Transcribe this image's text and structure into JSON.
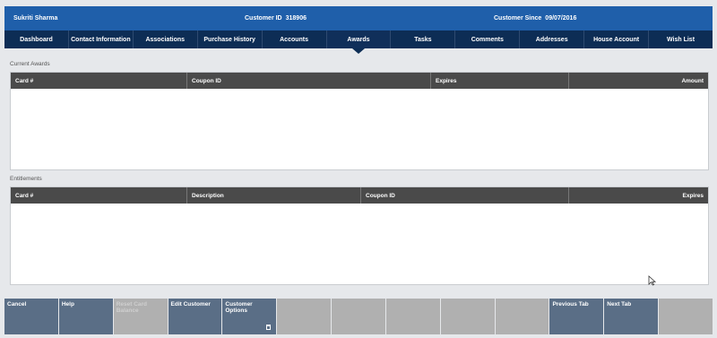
{
  "header": {
    "customer_name": "Sukriti Sharma",
    "customer_id_label": "Customer ID",
    "customer_id": "318906",
    "customer_since_label": "Customer Since",
    "customer_since": "09/07/2016"
  },
  "tabs": [
    {
      "label": "Dashboard"
    },
    {
      "label": "Contact Information"
    },
    {
      "label": "Associations"
    },
    {
      "label": "Purchase History"
    },
    {
      "label": "Accounts"
    },
    {
      "label": "Awards",
      "active": true
    },
    {
      "label": "Tasks"
    },
    {
      "label": "Comments"
    },
    {
      "label": "Addresses"
    },
    {
      "label": "House Account"
    },
    {
      "label": "Wish List"
    }
  ],
  "current_awards": {
    "title": "Current Awards",
    "columns": [
      "Card #",
      "Coupon ID",
      "Expires",
      "Amount"
    ],
    "rows": []
  },
  "entitlements": {
    "title": "Entitlements",
    "columns": [
      "Card #",
      "Description",
      "Coupon ID",
      "Expires"
    ],
    "rows": []
  },
  "footer": {
    "buttons": [
      {
        "label": "Cancel",
        "enabled": true
      },
      {
        "label": "Help",
        "enabled": true
      },
      {
        "label": "Reset Card Balance",
        "enabled": false
      },
      {
        "label": "Edit Customer",
        "enabled": true
      },
      {
        "label": "Customer Options",
        "enabled": true,
        "icon": "trash-icon"
      },
      {
        "label": "",
        "enabled": false
      },
      {
        "label": "",
        "enabled": false
      },
      {
        "label": "",
        "enabled": false
      },
      {
        "label": "",
        "enabled": false
      },
      {
        "label": "",
        "enabled": false
      },
      {
        "label": "Previous Tab",
        "enabled": true
      },
      {
        "label": "Next Tab",
        "enabled": true
      },
      {
        "label": "",
        "enabled": false
      }
    ]
  }
}
